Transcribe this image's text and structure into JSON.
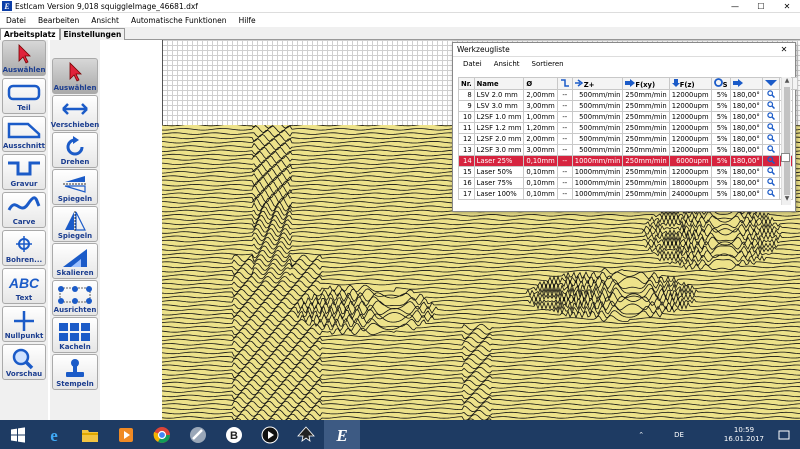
{
  "window": {
    "title": "Estlcam Version 9,018 squiggleImage_46681.dxf",
    "minimize": "—",
    "maximize": "☐",
    "close": "✕"
  },
  "menu": [
    "Datei",
    "Bearbeiten",
    "Ansicht",
    "Automatische Funktionen",
    "Hilfe"
  ],
  "tabs": [
    "Arbeitsplatz",
    "Einstellungen"
  ],
  "toolbar_left": [
    {
      "label": "Auswählen",
      "icon": "cursor-arrow-icon"
    },
    {
      "label": "Teil",
      "icon": "part-outline-icon"
    },
    {
      "label": "Ausschnitt",
      "icon": "cutout-icon"
    },
    {
      "label": "Gravur",
      "icon": "engrave-icon"
    },
    {
      "label": "Carve",
      "icon": "carve-icon"
    },
    {
      "label": "Bohren...",
      "icon": "drill-icon"
    },
    {
      "label": "Text",
      "icon": "text-abc-icon"
    },
    {
      "label": "Nullpunkt",
      "icon": "origin-cross-icon"
    },
    {
      "label": "Vorschau",
      "icon": "magnifier-icon"
    }
  ],
  "toolbar_right": [
    {
      "label": "Auswählen",
      "icon": "cursor-arrow-icon"
    },
    {
      "label": "Verschieben",
      "icon": "move-arrows-icon"
    },
    {
      "label": "Drehen",
      "icon": "rotate-icon"
    },
    {
      "label": "Spiegeln",
      "icon": "mirror-horizontal-icon"
    },
    {
      "label": "Spiegeln",
      "icon": "mirror-vertical-icon"
    },
    {
      "label": "Skalieren",
      "icon": "scale-icon"
    },
    {
      "label": "Ausrichten",
      "icon": "align-icon"
    },
    {
      "label": "Kacheln",
      "icon": "tile-grid-icon"
    },
    {
      "label": "Stempeln",
      "icon": "stamp-icon"
    }
  ],
  "toolwindow": {
    "title": "Werkzeugliste",
    "close": "✕",
    "menu": [
      "Datei",
      "Ansicht",
      "Sortieren"
    ],
    "columns": [
      "Nr.",
      "Name",
      "Ø",
      "",
      "Z+",
      "F(xy)",
      "F(z)",
      "S",
      "",
      ""
    ],
    "rows": [
      [
        "8",
        "LSV 2.0 mm",
        "2,00mm",
        "--",
        "500mm/min",
        "250mm/min",
        "12000upm",
        "5%",
        "180,00°"
      ],
      [
        "9",
        "LSV 3.0 mm",
        "3,00mm",
        "--",
        "500mm/min",
        "250mm/min",
        "12000upm",
        "5%",
        "180,00°"
      ],
      [
        "10",
        "L2SF 1.0 mm",
        "1,00mm",
        "--",
        "500mm/min",
        "250mm/min",
        "12000upm",
        "5%",
        "180,00°"
      ],
      [
        "11",
        "L2SF 1.2 mm",
        "1,20mm",
        "--",
        "500mm/min",
        "250mm/min",
        "12000upm",
        "5%",
        "180,00°"
      ],
      [
        "12",
        "L2SF 2.0 mm",
        "2,00mm",
        "--",
        "500mm/min",
        "250mm/min",
        "12000upm",
        "5%",
        "180,00°"
      ],
      [
        "13",
        "L2SF 3.0 mm",
        "3,00mm",
        "--",
        "500mm/min",
        "250mm/min",
        "12000upm",
        "5%",
        "180,00°"
      ],
      [
        "14",
        "Laser 25%",
        "0,10mm",
        "--",
        "1000mm/min",
        "250mm/min",
        "6000upm",
        "5%",
        "180,00°"
      ],
      [
        "15",
        "Laser 50%",
        "0,10mm",
        "--",
        "1000mm/min",
        "250mm/min",
        "12000upm",
        "5%",
        "180,00°"
      ],
      [
        "16",
        "Laser 75%",
        "0,10mm",
        "--",
        "1000mm/min",
        "250mm/min",
        "18000upm",
        "5%",
        "180,00°"
      ],
      [
        "17",
        "Laser 100%",
        "0,10mm",
        "--",
        "1000mm/min",
        "250mm/min",
        "24000upm",
        "5%",
        "180,00°"
      ]
    ],
    "selected_row_index": 6
  },
  "colors": {
    "accent": "#1b3d8f",
    "selection": "#d6243f",
    "wave_fill": "#ede28a",
    "wave_stroke": "#111111",
    "taskbar": "#1e3b63"
  },
  "taskbar": {
    "apps": [
      "windows-start-icon",
      "internet-explorer-icon",
      "file-explorer-icon",
      "media-player-icon",
      "chrome-icon",
      "tool-icon",
      "app-b-icon",
      "play-circle-icon",
      "inkscape-icon",
      "estlcam-icon"
    ],
    "language": "DE",
    "time": "10:59",
    "date": "16.01.2017"
  }
}
